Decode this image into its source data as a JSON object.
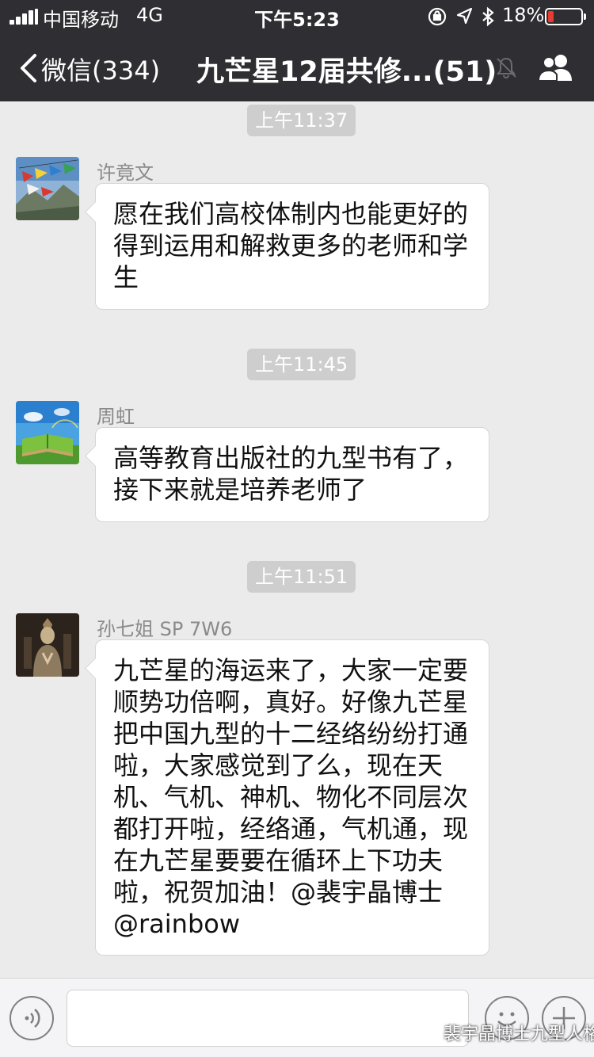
{
  "status_bar": {
    "carrier": "中国移动",
    "network": "4G",
    "time": "下午5:23",
    "battery_percent": "18%",
    "battery_level": 0.18,
    "battery_color": "#e83b32"
  },
  "nav": {
    "back_label": "微信(334)",
    "title": "九芒星12届共修...(51)",
    "icons": [
      "chevron-left-icon",
      "mute-bell-icon",
      "group-members-icon"
    ]
  },
  "messages": [
    {
      "timestamp": "上午11:37",
      "sender": "许竟文",
      "avatar": "prayer-flags-photo",
      "text": "愿在我们高校体制内也能更好的\n得到运用和解救更多的老师和学\n生"
    },
    {
      "timestamp": "上午11:45",
      "sender": "周虹",
      "avatar": "open-book-grass-photo",
      "text": "高等教育出版社的九型书有了，\n接下来就是培养老师了"
    },
    {
      "timestamp": "上午11:51",
      "sender": "孙七姐 SP 7W6",
      "avatar": "statue-photo",
      "text": "九芒星的海运来了，大家一定要\n顺势功倍啊，真好。好像九芒星\n把中国九型的十二经络纷纷打通\n啦，大家感觉到了么，现在天\n机、气机、神机、物化不同层次\n都打开啦，经络通，气机通，现\n在九芒星要要在循环上下功夫\n啦，祝贺加油！@裴宇晶博士\n@rainbow"
    }
  ],
  "input_bar": {
    "icons": [
      "voice-icon",
      "emoji-icon",
      "plus-icon"
    ]
  },
  "watermark": {
    "text": "裴宇晶博士九型人格"
  },
  "colors": {
    "nav_background": "#2f2f33",
    "chat_background": "#ebebeb",
    "timestamp_background": "#cecece"
  }
}
